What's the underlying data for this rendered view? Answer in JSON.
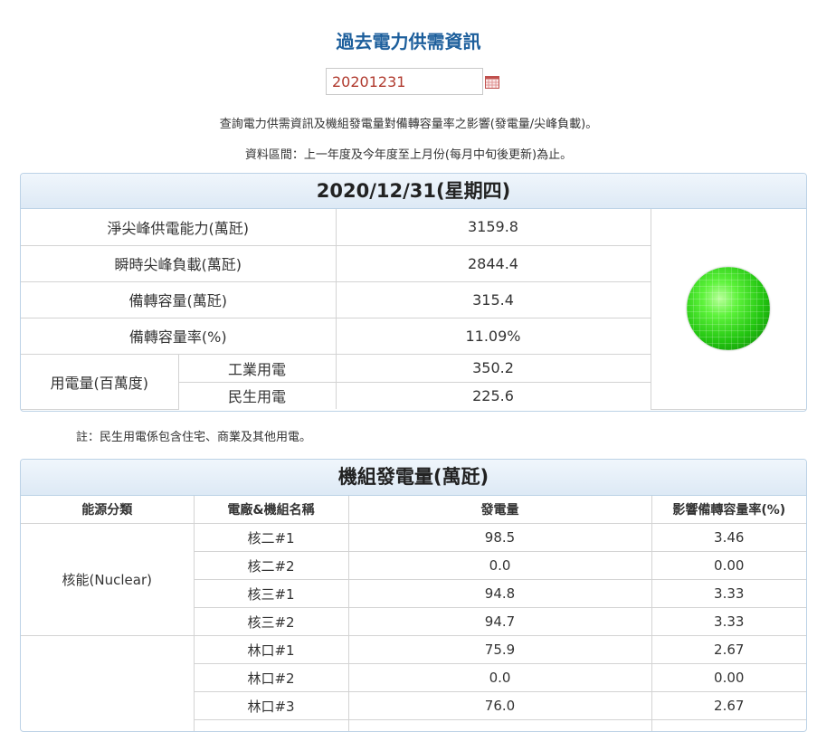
{
  "page": {
    "title": "過去電力供需資訊",
    "date_value": "20201231",
    "description": "查詢電力供需資訊及機組發電量對備轉容量率之影響(發電量/尖峰負載)。",
    "data_range": "資料區間：上一年度及今年度至上月份(每月中旬後更新)為止。"
  },
  "summary": {
    "date_title": "2020/12/31(星期四)",
    "net_peak_capacity": {
      "label": "淨尖峰供電能力(萬瓩)",
      "value": "3159.8"
    },
    "peak_load": {
      "label": "瞬時尖峰負載(萬瓩)",
      "value": "2844.4"
    },
    "reserve_capacity": {
      "label": "備轉容量(萬瓩)",
      "value": "315.4"
    },
    "reserve_rate": {
      "label": "備轉容量率(%)",
      "value": "11.09%"
    },
    "consumption": {
      "label": "用電量(百萬度)",
      "industrial": {
        "label": "工業用電",
        "value": "350.2"
      },
      "residential": {
        "label": "民生用電",
        "value": "225.6"
      }
    },
    "status_light_color": "#22c510"
  },
  "note": "註：民生用電係包含住宅、商業及其他用電。",
  "units": {
    "title": "機組發電量(萬瓩)",
    "headers": [
      "能源分類",
      "電廠&機組名稱",
      "發電量",
      "影響備轉容量率(%)"
    ],
    "groups": [
      {
        "category": "核能(Nuclear)",
        "rows": [
          {
            "name": "核二#1",
            "output": "98.5",
            "impact": "3.46"
          },
          {
            "name": "核二#2",
            "output": "0.0",
            "impact": "0.00"
          },
          {
            "name": "核三#1",
            "output": "94.8",
            "impact": "3.33"
          },
          {
            "name": "核三#2",
            "output": "94.7",
            "impact": "3.33"
          }
        ]
      },
      {
        "category": "",
        "rows": [
          {
            "name": "林口#1",
            "output": "75.9",
            "impact": "2.67"
          },
          {
            "name": "林口#2",
            "output": "0.0",
            "impact": "0.00"
          },
          {
            "name": "林口#3",
            "output": "76.0",
            "impact": "2.67"
          }
        ]
      }
    ]
  }
}
